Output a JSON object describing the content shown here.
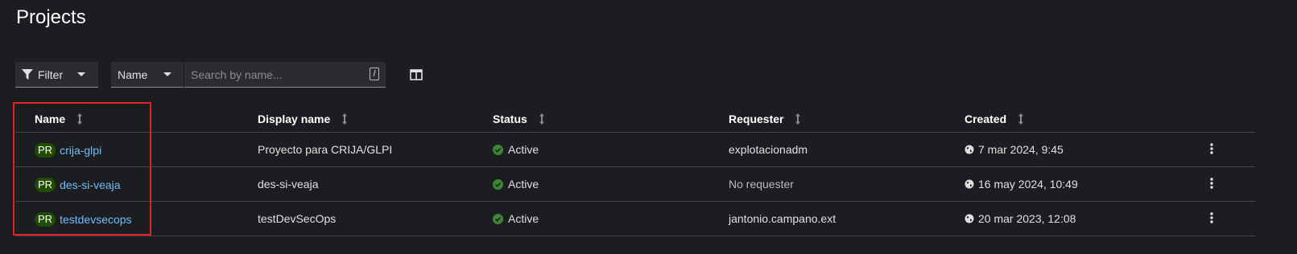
{
  "page": {
    "title": "Projects"
  },
  "toolbar": {
    "filter_label": "Filter",
    "filter_icon": "filter-icon",
    "search_by_label": "Name",
    "search_placeholder": "Search by name...",
    "search_value": "",
    "shortcut_key": "/",
    "columns_icon": "columns-icon"
  },
  "table": {
    "headers": {
      "name": "Name",
      "display_name": "Display name",
      "status": "Status",
      "requester": "Requester",
      "created": "Created"
    },
    "rows": [
      {
        "badge": "PR",
        "name": "crija-glpi",
        "display_name": "Proyecto para CRIJA/GLPI",
        "status": "Active",
        "requester": "explotacionadm",
        "created": "7 mar 2024, 9:45"
      },
      {
        "badge": "PR",
        "name": "des-si-veaja",
        "display_name": "des-si-veaja",
        "status": "Active",
        "requester": "No requester",
        "created": "16 may 2024, 10:49"
      },
      {
        "badge": "PR",
        "name": "testdevsecops",
        "display_name": "testDevSecOps",
        "status": "Active",
        "requester": "jantonio.campano.ext",
        "created": "20 mar 2023, 12:08"
      }
    ]
  },
  "colors": {
    "background": "#1b1d21",
    "link": "#73bcf7",
    "badge_bg": "#204d00",
    "status_ok": "#3e8635",
    "highlight": "#e61f26"
  }
}
